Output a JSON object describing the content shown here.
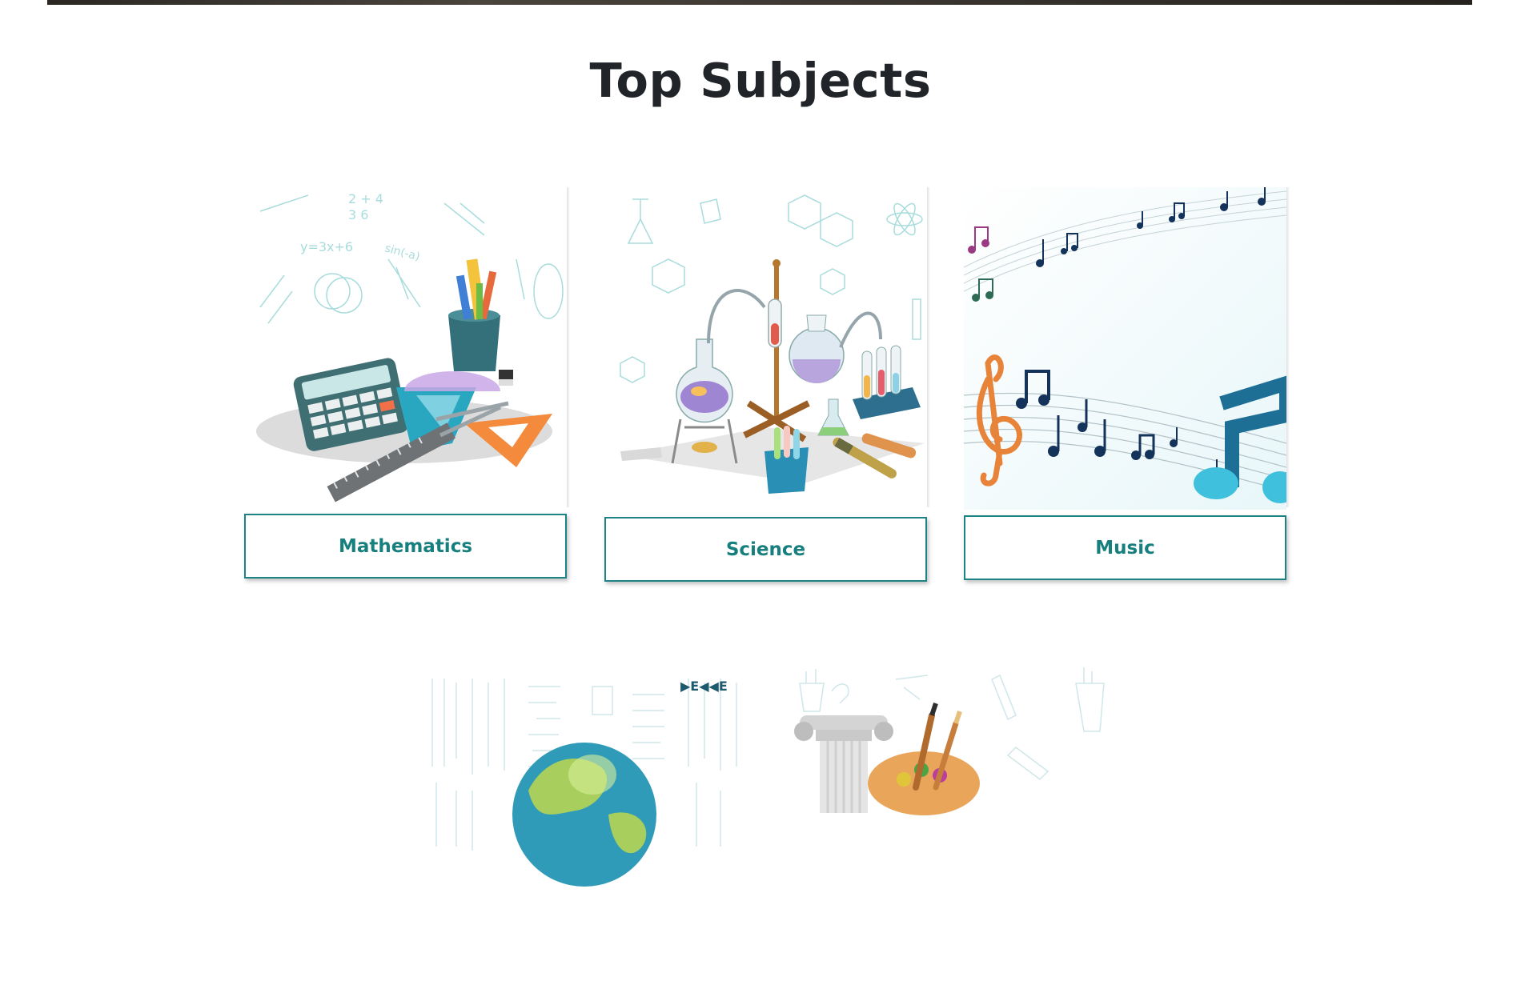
{
  "page": {
    "title": "Top Subjects"
  },
  "subjects": [
    {
      "label": "Mathematics",
      "image_icon": "math-tools-illustration"
    },
    {
      "label": "Science",
      "image_icon": "lab-equipment-illustration"
    },
    {
      "label": "Music",
      "image_icon": "music-notes-illustration"
    },
    {
      "label": "",
      "image_icon": "globe-illustration"
    },
    {
      "label": "",
      "image_icon": "art-palette-illustration"
    }
  ],
  "colors": {
    "accent": "#1d8384",
    "title_text": "#212529",
    "doodle": "#a8dcdc"
  }
}
